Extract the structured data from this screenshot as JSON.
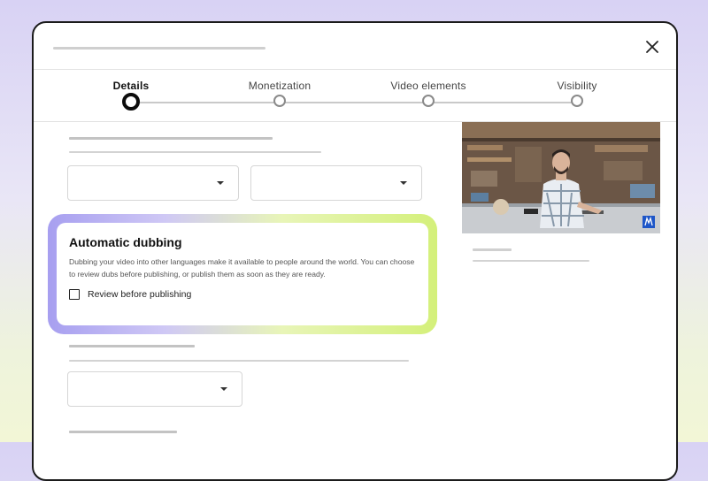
{
  "header": {
    "close_icon": "close-icon"
  },
  "stepper": {
    "steps": [
      {
        "label": "Details",
        "active": true
      },
      {
        "label": "Monetization",
        "active": false
      },
      {
        "label": "Video elements",
        "active": false
      },
      {
        "label": "Visibility",
        "active": false
      }
    ]
  },
  "dubbing": {
    "title": "Automatic dubbing",
    "description": "Dubbing your video into other languages make it available to people around the world. You can choose to review dubs before publishing, or publish them as soon as they are ready.",
    "checkbox_label": "Review before publishing",
    "checkbox_checked": false
  },
  "video": {
    "badge_icon": "brand-badge-icon"
  },
  "colors": {
    "glow_start": "#a79ff0",
    "glow_end": "#d4f07a",
    "active_step": "#0c0c0c"
  }
}
